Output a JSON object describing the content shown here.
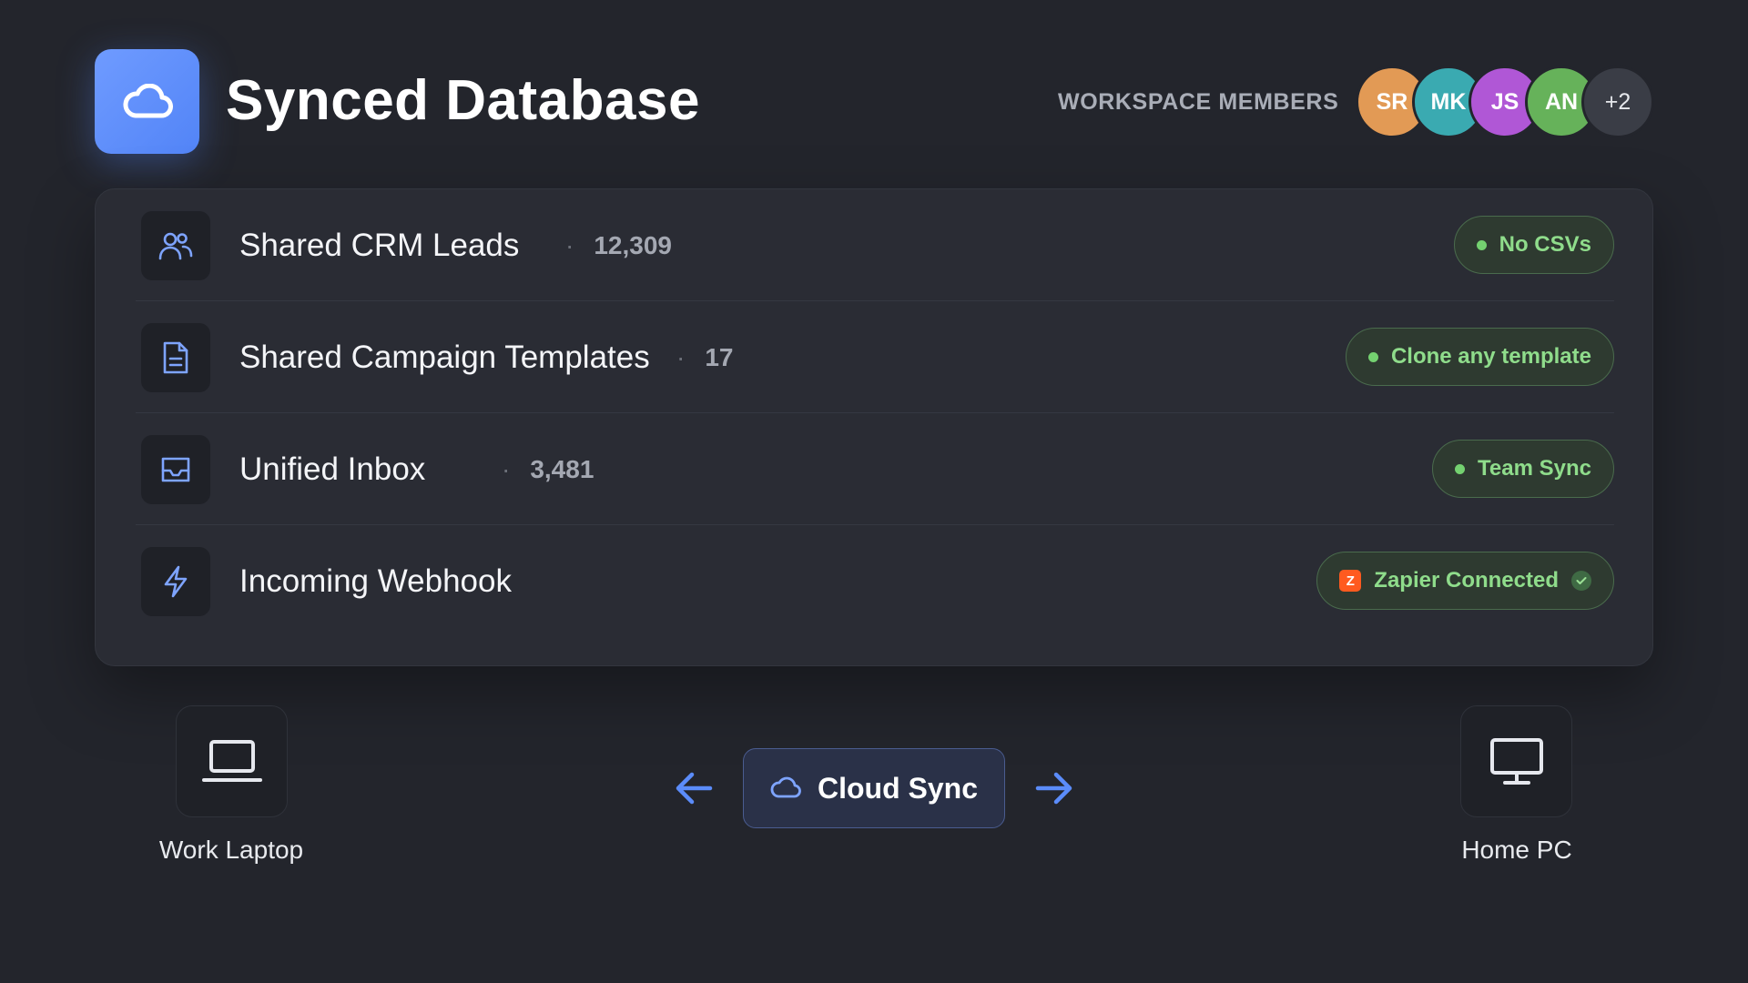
{
  "header": {
    "title": "Synced Database",
    "app_icon": "cloud-icon",
    "members_label": "WORKSPACE MEMBERS",
    "avatars": [
      {
        "initials": "SR",
        "color": "#e29a55"
      },
      {
        "initials": "MK",
        "color": "#3aaab1"
      },
      {
        "initials": "JS",
        "color": "#b057d6"
      },
      {
        "initials": "AN",
        "color": "#66b25a"
      },
      {
        "initials": "+2",
        "color": "#3a3d46"
      }
    ]
  },
  "rows": [
    {
      "icon": "users-icon",
      "title": "Shared CRM Leads",
      "count": "12,309",
      "badge": "No CSVs"
    },
    {
      "icon": "document-icon",
      "title": "Shared Campaign Templates",
      "count": "17",
      "badge": "Clone any template"
    },
    {
      "icon": "inbox-icon",
      "title": "Unified Inbox",
      "count": "3,481",
      "badge": "Team Sync"
    },
    {
      "icon": "lightning-icon",
      "title": "Incoming Webhook",
      "badge_logo": "Z",
      "badge": "Zapier Connected"
    }
  ],
  "sync": {
    "left_device": "Work Laptop",
    "right_device": "Home PC",
    "center_label": "Cloud Sync"
  },
  "colors": {
    "accent": "#5b8cfa",
    "status_green": "#8fdc8b",
    "background": "#23252c"
  }
}
